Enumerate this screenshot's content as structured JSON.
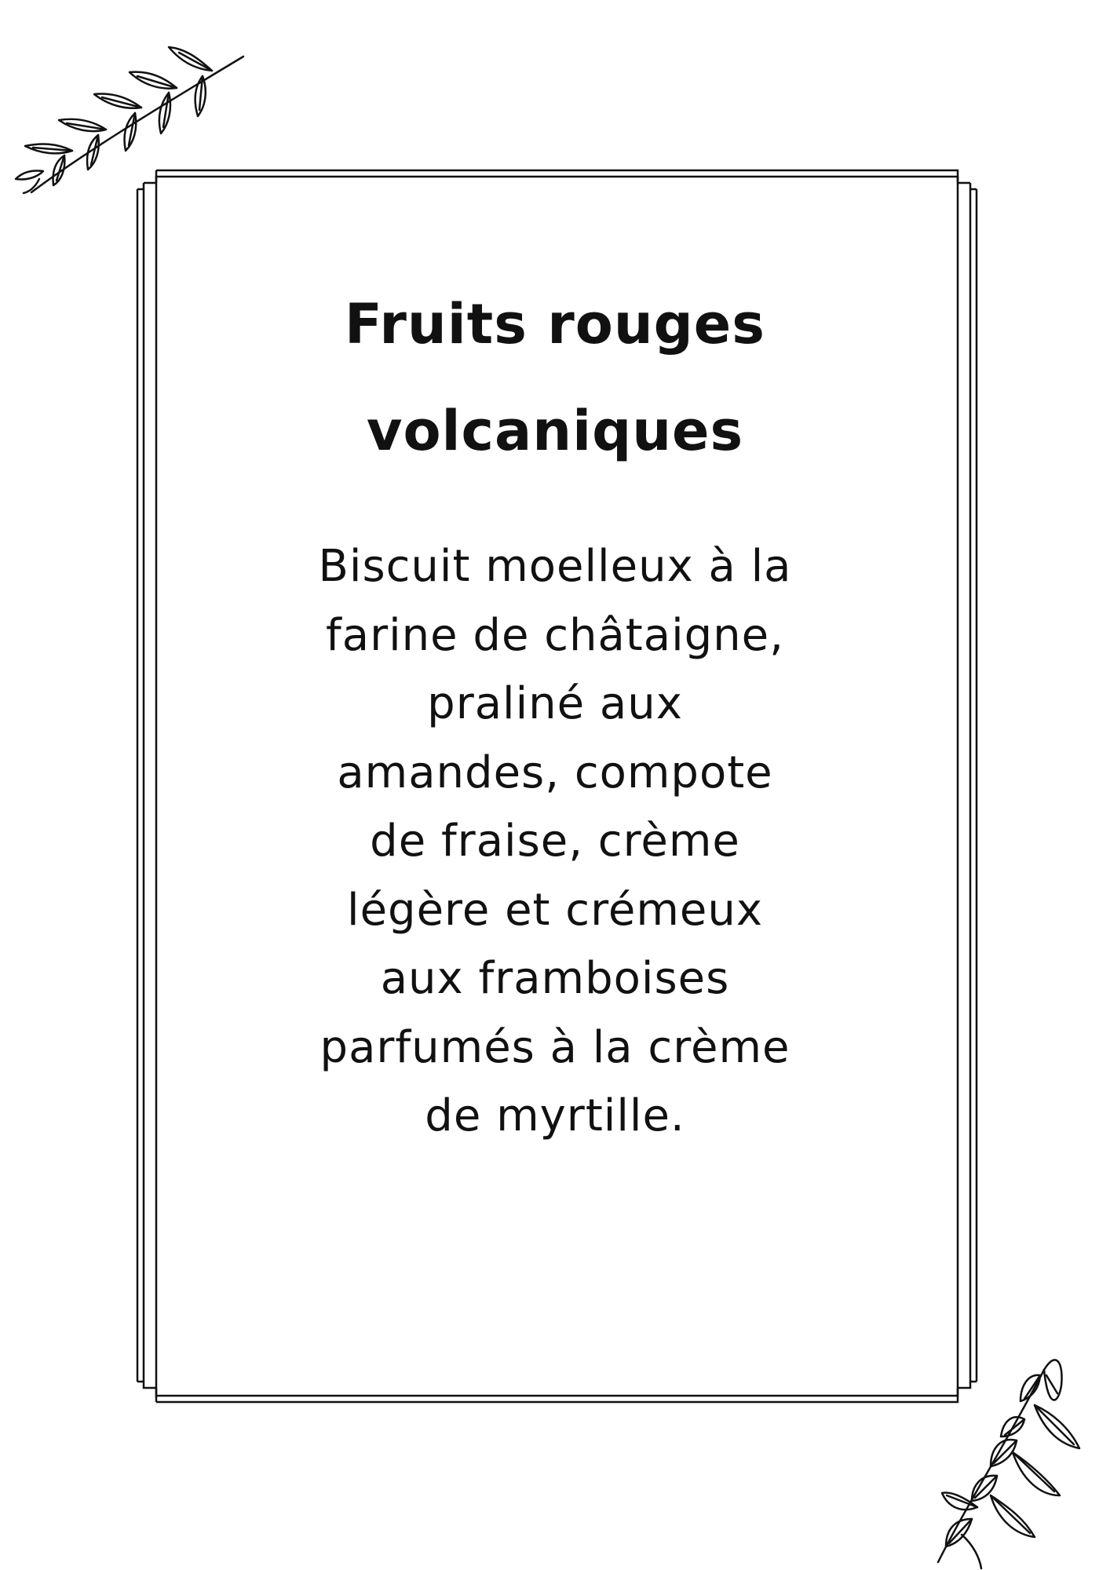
{
  "menu_card": {
    "title": "Fruits rouges\nvolcaniques",
    "description": "Biscuit moelleux à la\nfarine de châtaigne,\npraliné aux\namandes, compote\nde fraise, crème\nlégère et crémeux\naux framboises\nparfumés à la crème\nde myrtille."
  },
  "decorations": {
    "top_left": "leafy-branch-icon",
    "bottom_right": "leafy-branch-icon"
  },
  "colors": {
    "ink": "#111111",
    "background": "#ffffff"
  }
}
